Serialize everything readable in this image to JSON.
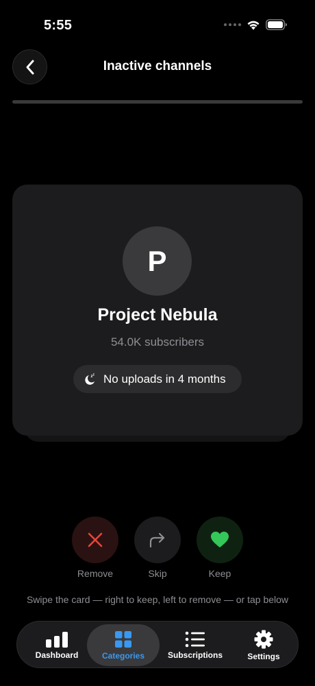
{
  "status_bar": {
    "time": "5:55",
    "icons": [
      "signal-dots-icon",
      "wifi-icon",
      "battery-icon"
    ]
  },
  "header": {
    "title": "Inactive channels",
    "back_icon": "chevron-left-icon",
    "progress_fraction": 0.0
  },
  "card": {
    "avatar_letter": "P",
    "channel_name": "Project Nebula",
    "subscribers": "54.0K subscribers",
    "inactive_icon": "moon-zzz-icon",
    "inactive_text": "No uploads in 4 months"
  },
  "actions": [
    {
      "label": "Remove",
      "icon": "x-icon",
      "color": "#e5453a"
    },
    {
      "label": "Skip",
      "icon": "share-arrow-icon",
      "color": "#8e8e93"
    },
    {
      "label": "Keep",
      "icon": "heart-icon",
      "color": "#34c759"
    }
  ],
  "hint": "Swipe the card — right to keep, left to remove — or tap below",
  "tabbar": {
    "active": "Categories",
    "accent": "#3a98f0",
    "tabs": [
      {
        "label": "Dashboard",
        "icon": "bar-chart-icon"
      },
      {
        "label": "Categories",
        "icon": "grid-icon"
      },
      {
        "label": "Subscriptions",
        "icon": "list-icon"
      },
      {
        "label": "Settings",
        "icon": "gear-icon"
      }
    ]
  }
}
